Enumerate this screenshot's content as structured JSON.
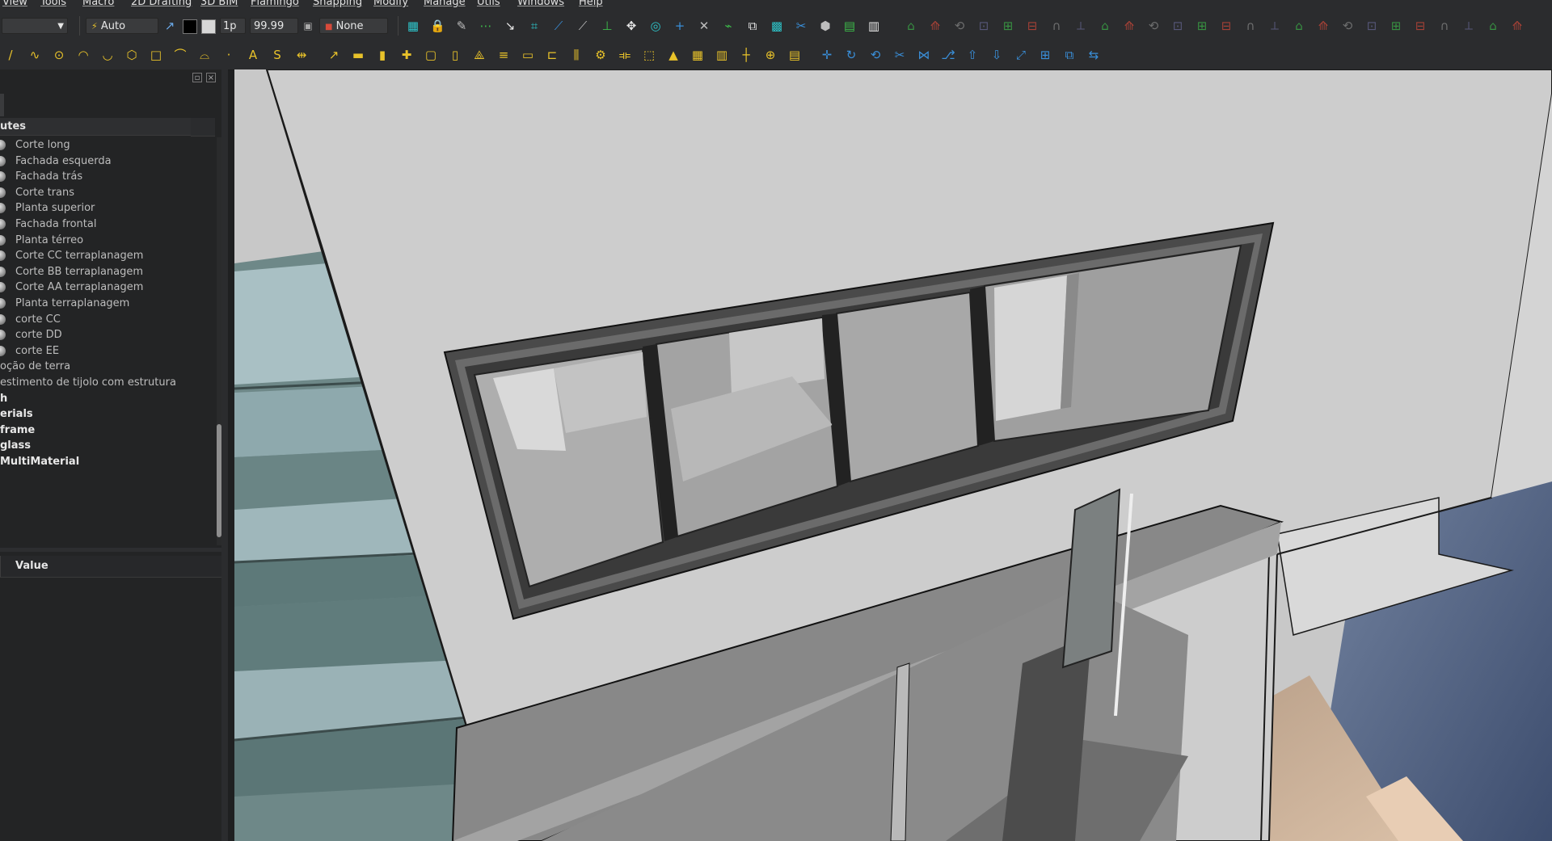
{
  "menu": [
    "View",
    "Tools",
    "Macro",
    "2D Drafting",
    "3D BIM",
    "Flamingo",
    "Snapping",
    "Modify",
    "Manage",
    "Utils",
    "Windows",
    "Help"
  ],
  "toolbar": {
    "style_dropdown": "",
    "auto_label": "Auto",
    "line_width": "1p",
    "font_size": "99.99",
    "working_plane": "None"
  },
  "tree": {
    "header": "utes",
    "items": [
      {
        "label": "Corte long",
        "kind": "view"
      },
      {
        "label": "Fachada esquerda",
        "kind": "view"
      },
      {
        "label": "Fachada trás",
        "kind": "view"
      },
      {
        "label": "Corte trans",
        "kind": "view"
      },
      {
        "label": "Planta superior",
        "kind": "view"
      },
      {
        "label": "Fachada frontal",
        "kind": "view"
      },
      {
        "label": "Planta térreo",
        "kind": "view"
      },
      {
        "label": "Corte CC terraplanagem",
        "kind": "view"
      },
      {
        "label": "Corte BB terraplanagem",
        "kind": "view"
      },
      {
        "label": "Corte AA terraplanagem",
        "kind": "view"
      },
      {
        "label": "Planta terraplanagem",
        "kind": "view"
      },
      {
        "label": "corte CC",
        "kind": "view"
      },
      {
        "label": "corte DD",
        "kind": "view"
      },
      {
        "label": "corte EE",
        "kind": "view"
      },
      {
        "label": "oção de terra",
        "kind": "plain"
      },
      {
        "label": "estimento de tijolo com estrutura",
        "kind": "plain"
      },
      {
        "label": "h",
        "kind": "bold"
      },
      {
        "label": "erials",
        "kind": "bold"
      },
      {
        "label": "frame",
        "kind": "bold"
      },
      {
        "label": "glass",
        "kind": "bold"
      },
      {
        "label": "MultiMaterial",
        "kind": "bold"
      }
    ]
  },
  "properties": {
    "value_header": "Value"
  },
  "icons": {
    "row1": [
      "dropdown-arrow",
      "draft-style",
      "color-black",
      "color-white",
      "spin",
      "grid-toggle",
      "snap-lock",
      "snap-endpoint",
      "snap-midpoint",
      "snap-center",
      "snap-angle",
      "snap-intersection",
      "snap-perpendicular",
      "snap-extension",
      "snap-parallel",
      "snap-special",
      "snap-near",
      "snap-ortho",
      "snap-grid",
      "snap-working-plane",
      "snap-dimensions",
      "tools",
      "part",
      "arch-wall",
      "arch-structure"
    ],
    "row2": [
      "line",
      "wire",
      "circle",
      "arc",
      "arc-3pt",
      "polygon",
      "rectangle",
      "bspline",
      "bezier",
      "point",
      "text",
      "shapestring",
      "dimension",
      "label",
      "wall",
      "structure",
      "rebar",
      "window",
      "door",
      "roof",
      "stairs",
      "panel",
      "frame",
      "fence",
      "equipment",
      "pipe",
      "space",
      "site",
      "building",
      "floor",
      "axis",
      "section",
      "schedule",
      "move",
      "rotate",
      "offset",
      "trimex",
      "join",
      "split",
      "upgrade",
      "downgrade",
      "scale",
      "array",
      "clone",
      "mirror"
    ]
  },
  "colors": {
    "accent_yellow": "#e8c22a",
    "accent_blue": "#3a8fd9",
    "accent_green": "#3dbb4a",
    "accent_red": "#d84a3a",
    "accent_cyan": "#2ec4c9"
  }
}
